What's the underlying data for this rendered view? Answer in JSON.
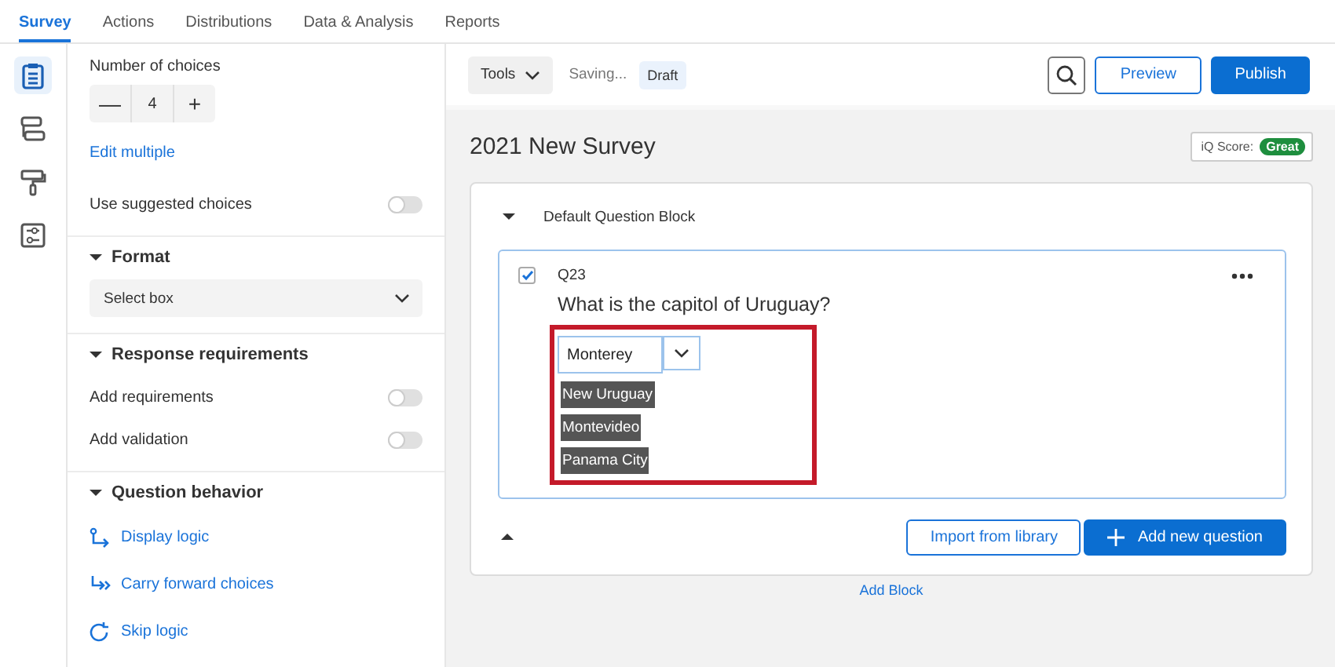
{
  "tabs": [
    {
      "label": "Survey",
      "selected": true
    },
    {
      "label": "Actions",
      "selected": false
    },
    {
      "label": "Distributions",
      "selected": false
    },
    {
      "label": "Data & Analysis",
      "selected": false
    },
    {
      "label": "Reports",
      "selected": false
    }
  ],
  "rail": [
    {
      "kind": "survey",
      "selected": true
    },
    {
      "kind": "flow",
      "selected": false
    },
    {
      "kind": "style",
      "selected": false
    },
    {
      "kind": "options",
      "selected": false
    }
  ],
  "panel": {
    "choices_label": "Number of choices",
    "minus": "—",
    "count": "4",
    "plus": "+",
    "edit_multiple": "Edit multiple",
    "suggested": {
      "label": "Use suggested choices",
      "on": false
    },
    "sections": [
      {
        "title": "Format",
        "expanded": true,
        "items": [
          {
            "kind": "select",
            "label": "Select box"
          }
        ]
      },
      {
        "title": "Response requirements",
        "expanded": true,
        "items": [
          {
            "kind": "toggle",
            "label": "Add requirements",
            "on": false
          },
          {
            "kind": "toggle",
            "label": "Add validation",
            "on": false
          }
        ]
      },
      {
        "title": "Question behavior",
        "expanded": true,
        "items": [
          {
            "kind": "link",
            "label": "Display logic"
          },
          {
            "kind": "link",
            "label": "Carry forward choices"
          },
          {
            "kind": "link",
            "label": "Skip logic"
          }
        ]
      }
    ]
  },
  "toolbar": {
    "tools": "Tools",
    "status": "Saving...",
    "badge": "Draft",
    "preview": "Preview",
    "publish": "Publish"
  },
  "survey": {
    "title": "2021 New Survey",
    "iq_label": "iQ Score:",
    "iq_value": "Great",
    "block": {
      "title": "Default Question Block",
      "expanded": true,
      "question": {
        "checked": true,
        "id": "Q23",
        "text": "What is the capitol of Uruguay?",
        "value": "Monterey",
        "suggestions": [
          "New Uruguay",
          "Montevideo",
          "Panama City"
        ]
      },
      "import": "Import from library",
      "add": "Add new question"
    },
    "add_block": "Add Block"
  }
}
